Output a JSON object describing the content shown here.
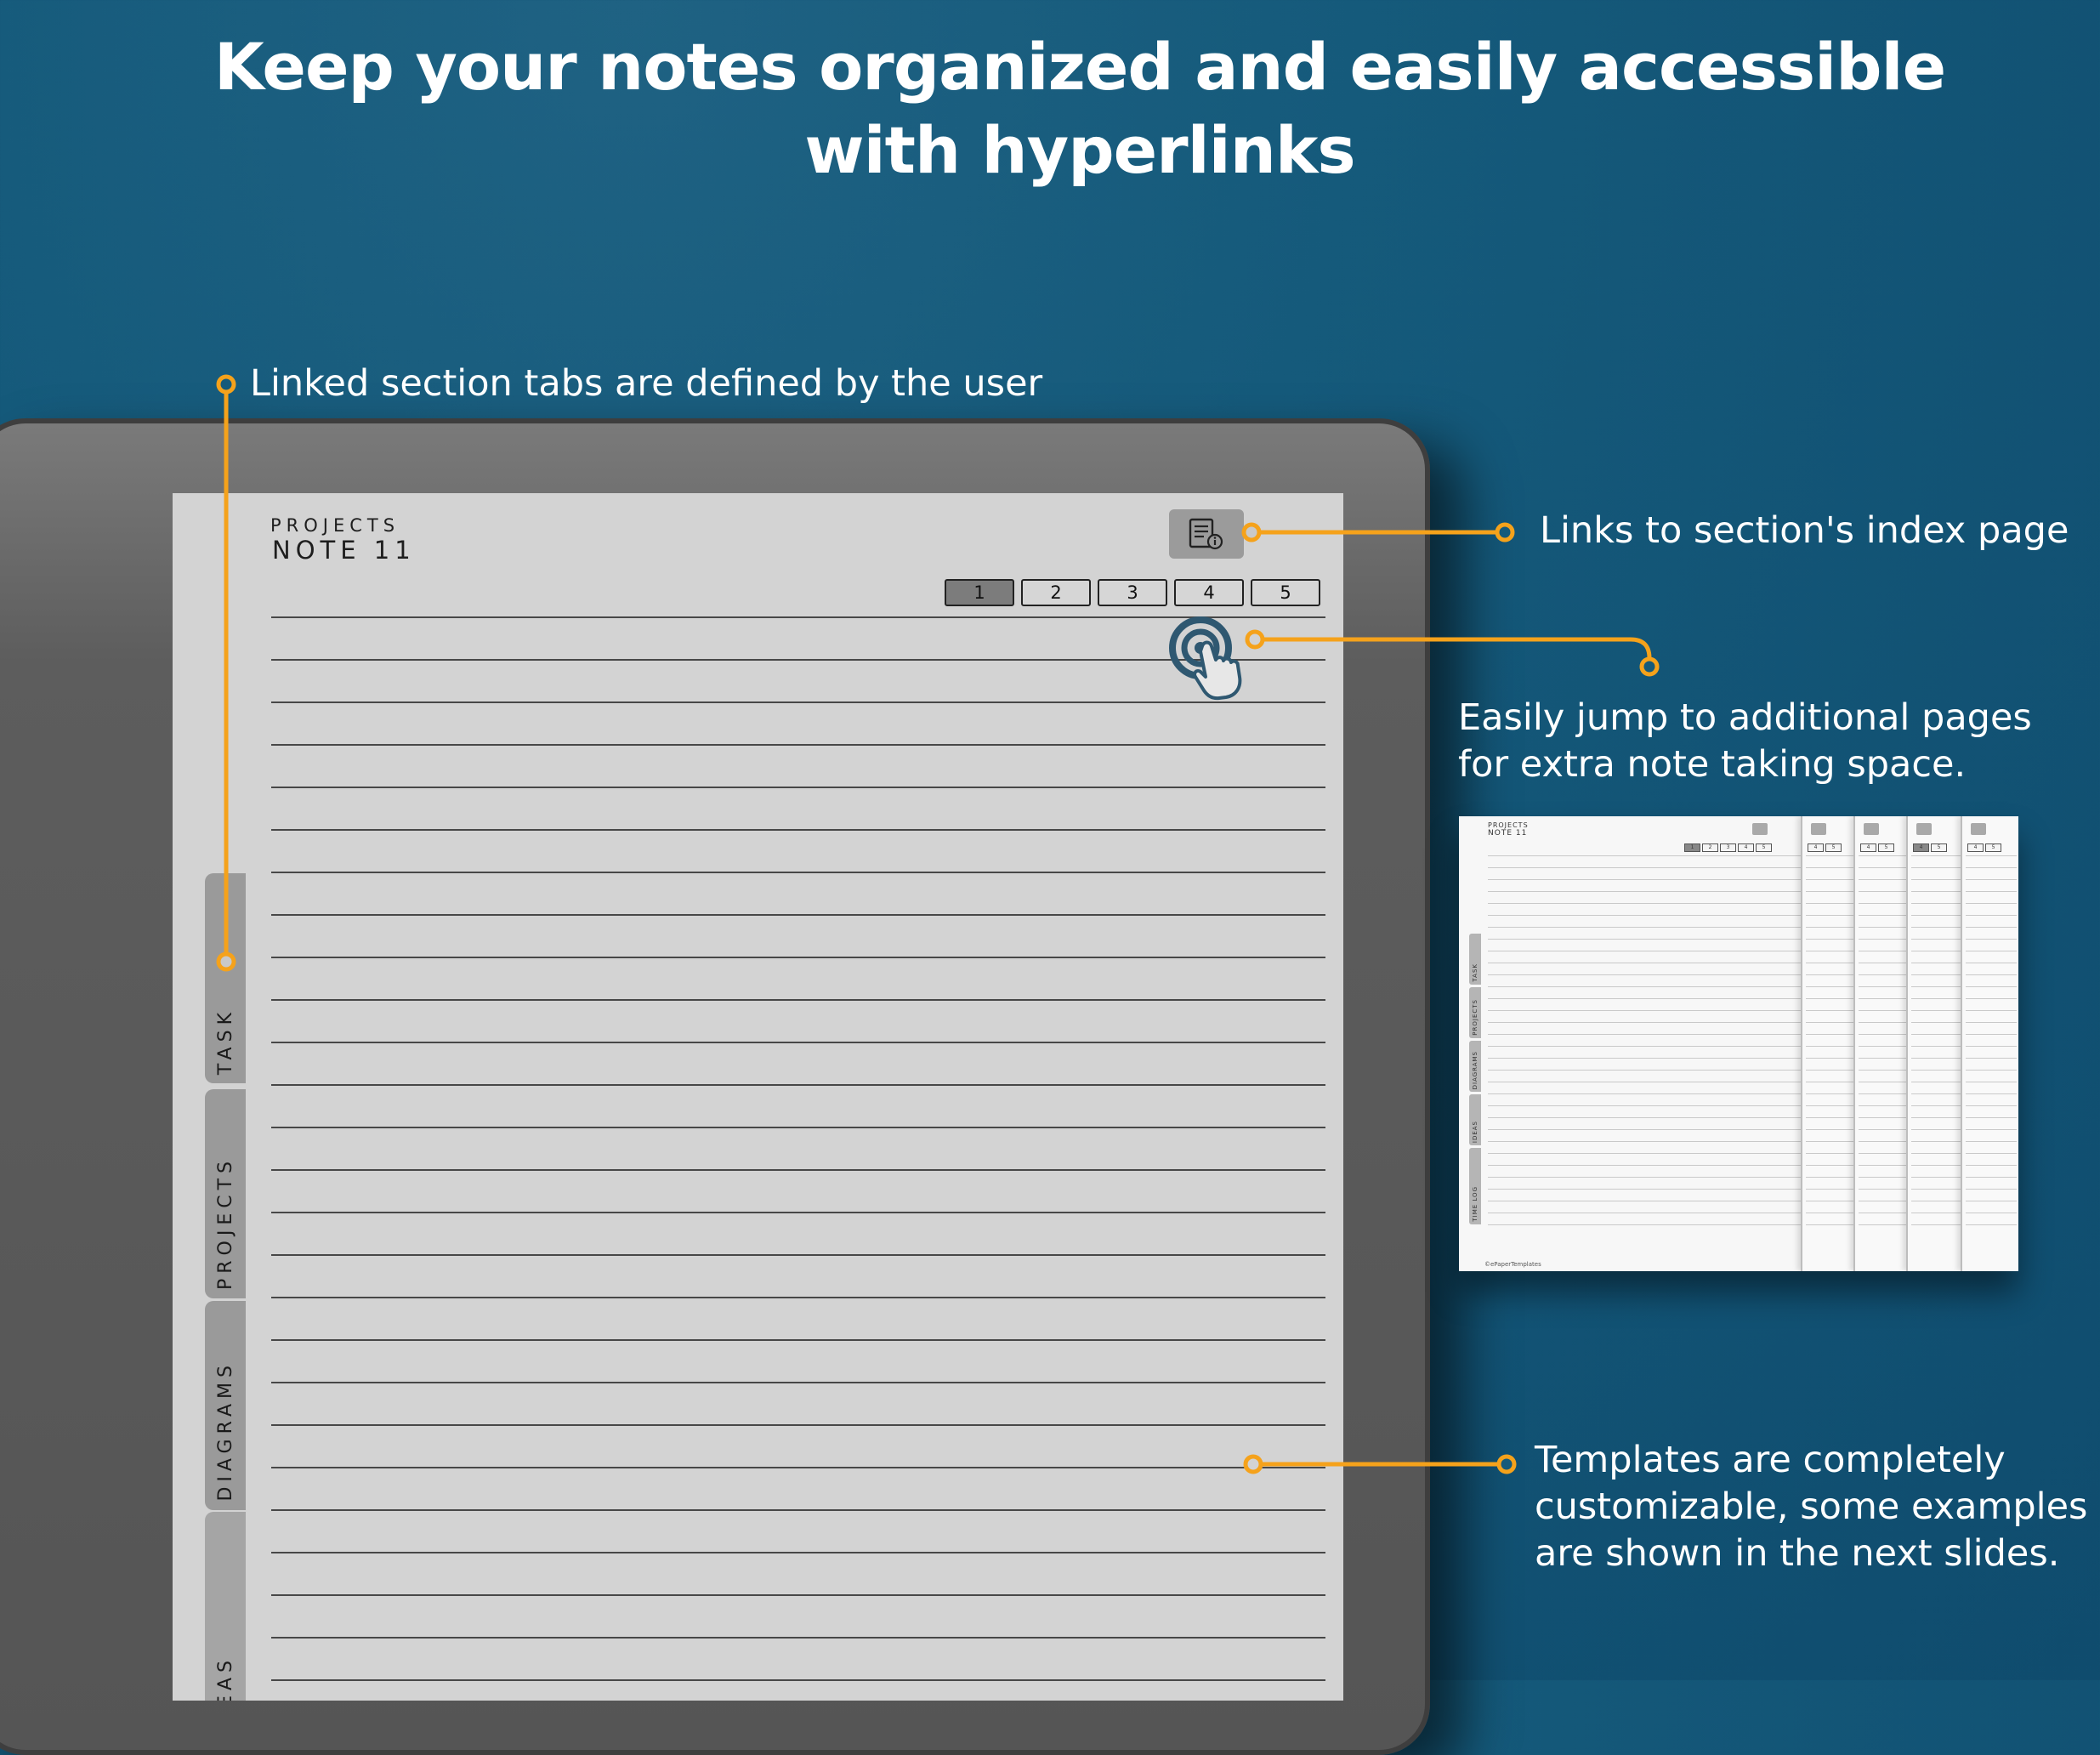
{
  "headline": {
    "line1": "Keep your notes organized and easily accessible",
    "line2": "with hyperlinks"
  },
  "callouts": {
    "section_tabs": "Linked section tabs are defined by the user",
    "index_link": "Links to section's index page",
    "jump_pages_line1": "Easily jump to additional pages",
    "jump_pages_line2": "for extra note taking space.",
    "templates_line1": "Templates are completely",
    "templates_line2": "customizable, some examples",
    "templates_line3": "are shown in the next slides."
  },
  "note": {
    "section": "PROJECTS",
    "title": "NOTE 11",
    "pages": [
      "1",
      "2",
      "3",
      "4",
      "5"
    ],
    "active_page": "1"
  },
  "side_tabs": [
    "TASK",
    "PROJECTS",
    "DIAGRAMS",
    "EAS"
  ],
  "thumbnail": {
    "section": "PROJECTS",
    "title": "NOTE 11",
    "side_tabs": [
      "TASK",
      "PROJECTS",
      "DIAGRAMS",
      "IDEAS",
      "TIME LOG"
    ],
    "extra_page_nums": [
      [
        "4",
        "5"
      ],
      [
        "4",
        "5"
      ],
      [
        "4",
        "5"
      ],
      [
        "4",
        "5"
      ]
    ],
    "footer": "©ePaperTemplates"
  },
  "colors": {
    "background": "#155a7b",
    "accent": "#f5a21b",
    "screen": "#d3d3d3"
  },
  "icons": [
    "index-page-icon",
    "tap-hand-icon",
    "pen-button-icon"
  ]
}
